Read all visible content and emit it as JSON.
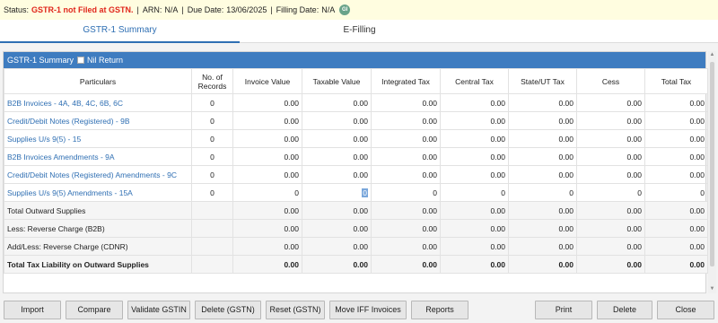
{
  "status": {
    "status_label": "Status:",
    "status_value": "GSTR-1 not Filed at GSTN.",
    "arn_label": "ARN:",
    "arn_value": "N/A",
    "due_label": "Due Date:",
    "due_value": "13/06/2025",
    "filing_label": "Filling Date:",
    "filing_value": "N/A",
    "gi_badge": "GI",
    "separator": "|"
  },
  "tabs": [
    {
      "label": "GSTR-1 Summary",
      "active": true
    },
    {
      "label": "E-Filling",
      "active": false
    }
  ],
  "panel": {
    "title": "GSTR-1 Summary",
    "nil_return_label": "Nil Return"
  },
  "table": {
    "headers": [
      "Particulars",
      "No. of Records",
      "Invoice Value",
      "Taxable Value",
      "Integrated Tax",
      "Central Tax",
      "State/UT Tax",
      "Cess",
      "Total Tax"
    ],
    "rows": [
      [
        "B2B Invoices - 4A, 4B, 4C, 6B, 6C",
        "0",
        "0.00",
        "0.00",
        "0.00",
        "0.00",
        "0.00",
        "0.00",
        "0.00"
      ],
      [
        "Credit/Debit Notes (Registered) - 9B",
        "0",
        "0.00",
        "0.00",
        "0.00",
        "0.00",
        "0.00",
        "0.00",
        "0.00"
      ],
      [
        "Supplies U/s 9(5) - 15",
        "0",
        "0.00",
        "0.00",
        "0.00",
        "0.00",
        "0.00",
        "0.00",
        "0.00"
      ],
      [
        "B2B Invoices Amendments - 9A",
        "0",
        "0.00",
        "0.00",
        "0.00",
        "0.00",
        "0.00",
        "0.00",
        "0.00"
      ],
      [
        "Credit/Debit Notes (Registered) Amendments - 9C",
        "0",
        "0.00",
        "0.00",
        "0.00",
        "0.00",
        "0.00",
        "0.00",
        "0.00"
      ],
      [
        "Supplies U/s 9(5) Amendments - 15A",
        "0",
        "0",
        "0",
        "0",
        "0",
        "0",
        "0",
        "0"
      ],
      [
        "Total Outward Supplies",
        "",
        "0.00",
        "0.00",
        "0.00",
        "0.00",
        "0.00",
        "0.00",
        "0.00"
      ],
      [
        "Less: Reverse Charge (B2B)",
        "",
        "0.00",
        "0.00",
        "0.00",
        "0.00",
        "0.00",
        "0.00",
        "0.00"
      ],
      [
        "Add/Less: Reverse Charge (CDNR)",
        "",
        "0.00",
        "0.00",
        "0.00",
        "0.00",
        "0.00",
        "0.00",
        "0.00"
      ],
      [
        "Total Tax Liability on Outward Supplies",
        "",
        "0.00",
        "0.00",
        "0.00",
        "0.00",
        "0.00",
        "0.00",
        "0.00"
      ]
    ]
  },
  "buttons": {
    "import": "Import",
    "compare": "Compare",
    "validate": "Validate GSTIN",
    "delete_gstn": "Delete (GSTN)",
    "reset_gstn": "Reset (GSTN)",
    "move_iff": "Move IFF Invoices",
    "reports": "Reports",
    "print": "Print",
    "delete": "Delete",
    "close": "Close"
  },
  "colors": {
    "accent": "#3e7cc0",
    "link": "#2f6fb3",
    "status_red": "#e0261c",
    "status_bar_bg": "#fffde0"
  }
}
